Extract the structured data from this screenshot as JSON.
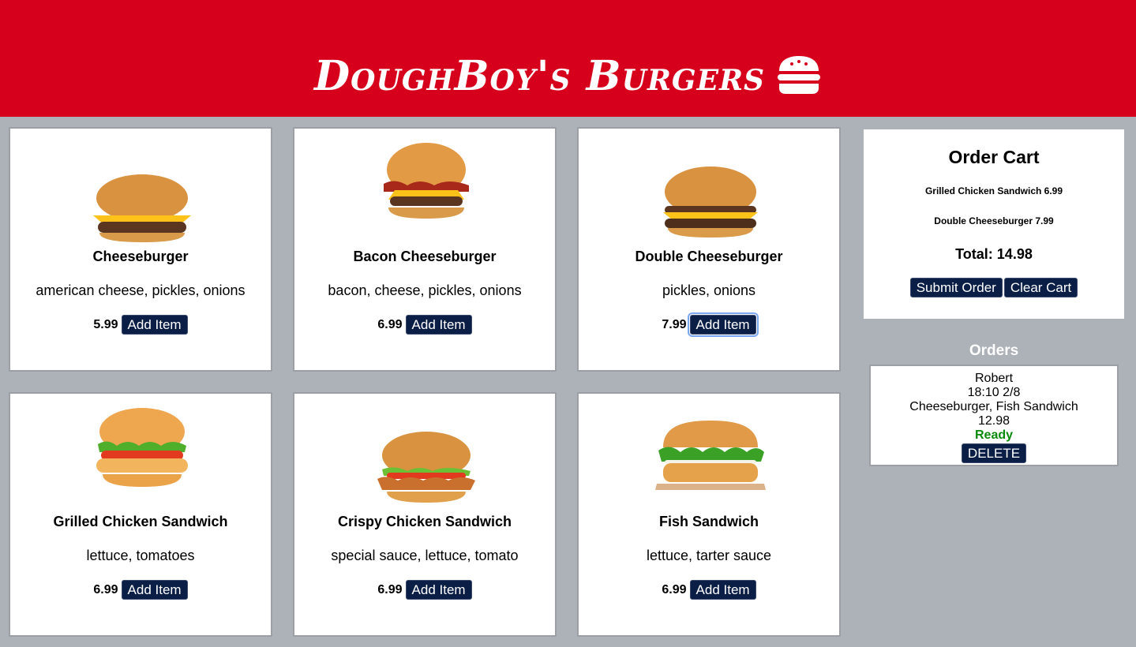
{
  "header": {
    "brand": "DoughBoy's Burgers"
  },
  "menu": [
    {
      "name": "Cheeseburger",
      "desc": "american cheese, pickles, onions",
      "price": "5.99",
      "button": "Add Item"
    },
    {
      "name": "Bacon Cheeseburger",
      "desc": "bacon, cheese, pickles, onions",
      "price": "6.99",
      "button": "Add Item"
    },
    {
      "name": "Double Cheeseburger",
      "desc": "pickles, onions",
      "price": "7.99",
      "button": "Add Item"
    },
    {
      "name": "Grilled Chicken Sandwich",
      "desc": "lettuce, tomatoes",
      "price": "6.99",
      "button": "Add Item"
    },
    {
      "name": "Crispy Chicken Sandwich",
      "desc": "special sauce, lettuce, tomato",
      "price": "6.99",
      "button": "Add Item"
    },
    {
      "name": "Fish Sandwich",
      "desc": "lettuce, tarter sauce",
      "price": "6.99",
      "button": "Add Item"
    }
  ],
  "cart": {
    "title": "Order Cart",
    "items": [
      "Grilled Chicken Sandwich 6.99",
      "Double Cheeseburger 7.99"
    ],
    "total": "Total: 14.98",
    "submit": "Submit Order",
    "clear": "Clear Cart"
  },
  "orders": {
    "title": "Orders",
    "list": [
      {
        "name": "Robert",
        "time": "18:10 2/8",
        "items": "Cheeseburger, Fish Sandwich",
        "total": "12.98",
        "status": "Ready",
        "delete": "DELETE"
      }
    ]
  },
  "colors": {
    "header": "#d7001c",
    "background": "#adb2b8",
    "button": "#0b1e46",
    "ready": "#0a8a0a"
  },
  "icons": {
    "brand": "burger-icon"
  }
}
